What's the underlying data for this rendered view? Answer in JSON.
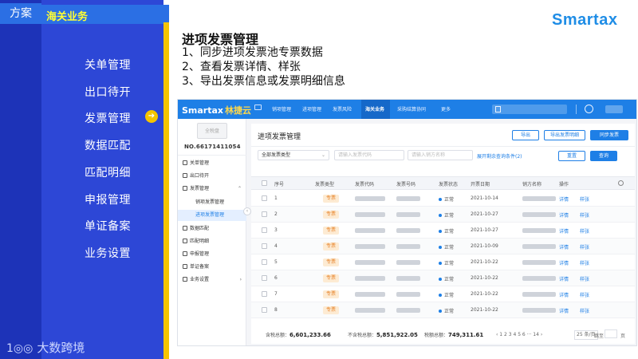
{
  "slide": {
    "tab_fangan": "方案",
    "tab_haiguan": "海关业务",
    "menu": [
      "关单管理",
      "出口待开",
      "发票管理",
      "数据匹配",
      "匹配明细",
      "申报管理",
      "单证备案",
      "业务设置"
    ],
    "active_menu": "发票管理",
    "brand_left": "大数跨境",
    "brand_right": "Smartax",
    "title": "进项发票管理",
    "points": [
      "1、同步进项发票池专票数据",
      "2、查看发票详情、样张",
      "3、导出发票信息或发票明细信息"
    ]
  },
  "app": {
    "logo_brand": "Smartax",
    "logo_suffix": "林捷云",
    "nav": [
      "销项管理",
      "进项管理",
      "发票风险",
      "海关业务",
      "采购结算协同",
      "更多"
    ],
    "nav_active": "海关业务",
    "logo_placeholder": "全税盘",
    "tax_id": "NO.66171411054",
    "side_menu": [
      "关单管理",
      "出口待开",
      "发票管理",
      "数据匹配",
      "匹配明细",
      "申报管理",
      "单证备案",
      "业务设置"
    ],
    "side_sub": [
      "销项发票管理",
      "进项发票管理"
    ],
    "side_sub_active": "进项发票管理",
    "page_title": "进项发票管理",
    "buttons": [
      "导出",
      "导出发票明细",
      "同步发票",
      "重置",
      "查询"
    ],
    "filter_type": "全部发票类型",
    "filter_code_placeholder": "请输入发票代码",
    "filter_seller_placeholder": "请输入销方名称",
    "expand_label": "展开剩余查询条件(2)",
    "headers": [
      "序号",
      "发票类型",
      "发票代码",
      "发票号码",
      "发票状态",
      "开票日期",
      "销方名称",
      "操作"
    ],
    "rows": [
      {
        "no": "1",
        "type": "专票",
        "status": "正常",
        "date": "2021-10-14"
      },
      {
        "no": "2",
        "type": "专票",
        "status": "正常",
        "date": "2021-10-27"
      },
      {
        "no": "3",
        "type": "专票",
        "status": "正常",
        "date": "2021-10-27"
      },
      {
        "no": "4",
        "type": "专票",
        "status": "正常",
        "date": "2021-10-09"
      },
      {
        "no": "5",
        "type": "专票",
        "status": "正常",
        "date": "2021-10-22"
      },
      {
        "no": "6",
        "type": "专票",
        "status": "正常",
        "date": "2021-10-22"
      },
      {
        "no": "7",
        "type": "专票",
        "status": "正常",
        "date": "2021-10-22"
      },
      {
        "no": "8",
        "type": "专票",
        "status": "正常",
        "date": "2021-10-22"
      }
    ],
    "action_detail": "详情",
    "action_sample": "样张",
    "footer": {
      "total_tax_label": "含税总额：",
      "total_tax": "6,601,233.66",
      "total_notax_label": "不含税总额：",
      "total_notax": "5,851,922.05",
      "total_vat_label": "税额总额：",
      "total_vat": "749,311.61"
    },
    "pager": {
      "pages": "‹ 1 2 3 4 5 6 ··· 14 ›",
      "page_size": "25 条/页",
      "goto_label": "跳至",
      "page_suffix": "页"
    }
  },
  "colors": {
    "slide_blue": "#2d47d6",
    "strip_blue": "#1d33b8",
    "accent_yellow": "#f5c400",
    "app_blue": "#1e7fe6",
    "tag_orange": "#e67e22"
  }
}
